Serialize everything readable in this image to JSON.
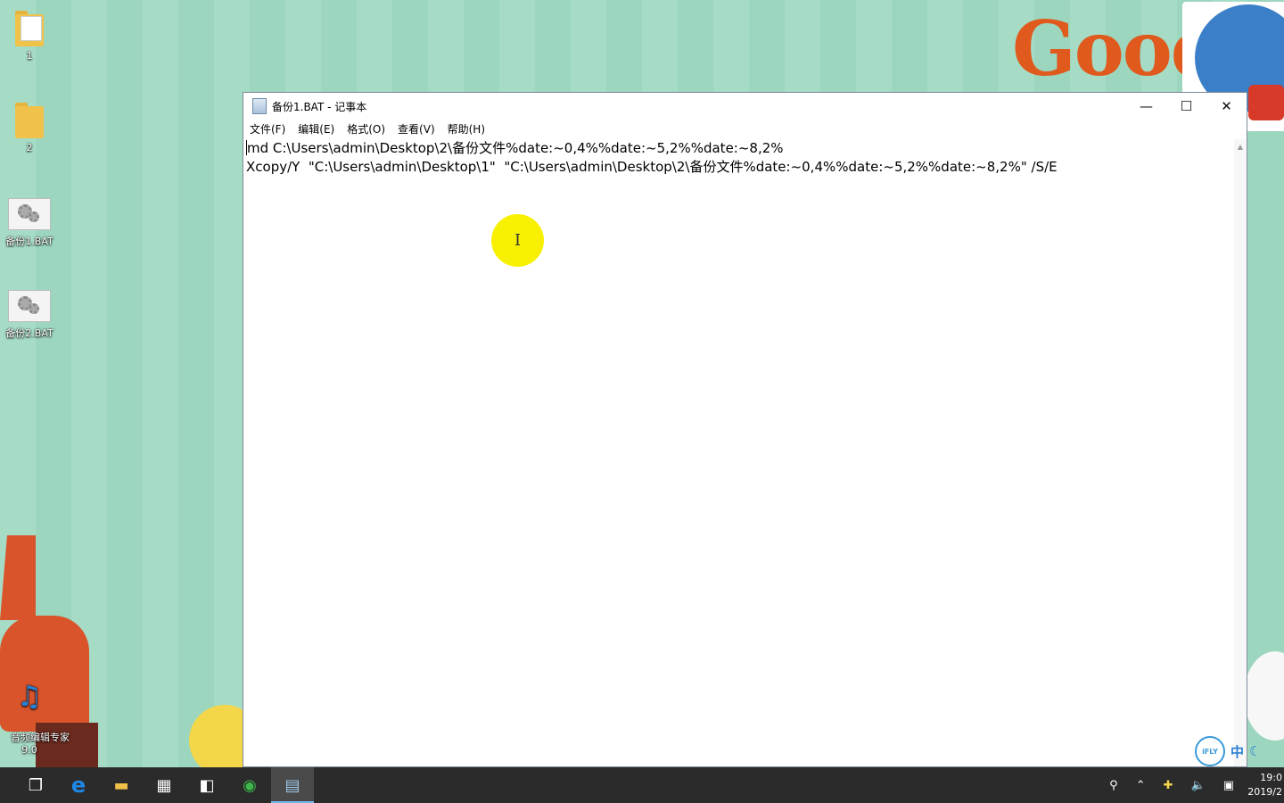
{
  "desktop": {
    "icons": [
      {
        "label": "1",
        "type": "folder"
      },
      {
        "label": "2",
        "type": "folder"
      },
      {
        "label": "备份1.BAT",
        "type": "bat"
      },
      {
        "label": "备份2.BAT",
        "type": "bat"
      },
      {
        "label": "音频编辑专家\n9.0",
        "type": "app"
      }
    ],
    "wallpaper_text": "Good"
  },
  "window": {
    "title": "备份1.BAT - 记事本",
    "menus": [
      "文件(F)",
      "编辑(E)",
      "格式(O)",
      "查看(V)",
      "帮助(H)"
    ],
    "controls": {
      "minimize": "—",
      "maximize": "☐",
      "close": "✕"
    },
    "lines": [
      "md C:\\Users\\admin\\Desktop\\2\\备份文件%date:~0,4%%date:~5,2%%date:~8,2%",
      "Xcopy/Y  \"C:\\Users\\admin\\Desktop\\1\"  \"C:\\Users\\admin\\Desktop\\2\\备份文件%date:~0,4%%date:~5,2%%date:~8,2%\" /S/E"
    ]
  },
  "ime": {
    "logo": "iFLY",
    "mode": "中"
  },
  "taskbar": {
    "apps": [
      {
        "name": "task-view",
        "glyph": "❐"
      },
      {
        "name": "edge",
        "glyph": "e"
      },
      {
        "name": "file-explorer",
        "glyph": "▬"
      },
      {
        "name": "store",
        "glyph": "▦"
      },
      {
        "name": "app-window",
        "glyph": "◧"
      },
      {
        "name": "green-app",
        "glyph": "◉"
      },
      {
        "name": "notepad",
        "glyph": "▤"
      }
    ],
    "clock_time": "19:0",
    "clock_date": "2019/2"
  },
  "colors": {
    "taskbar": "#2b2b2b",
    "active_indicator": "#76b9ed",
    "cursor_highlight": "#f7f000"
  }
}
